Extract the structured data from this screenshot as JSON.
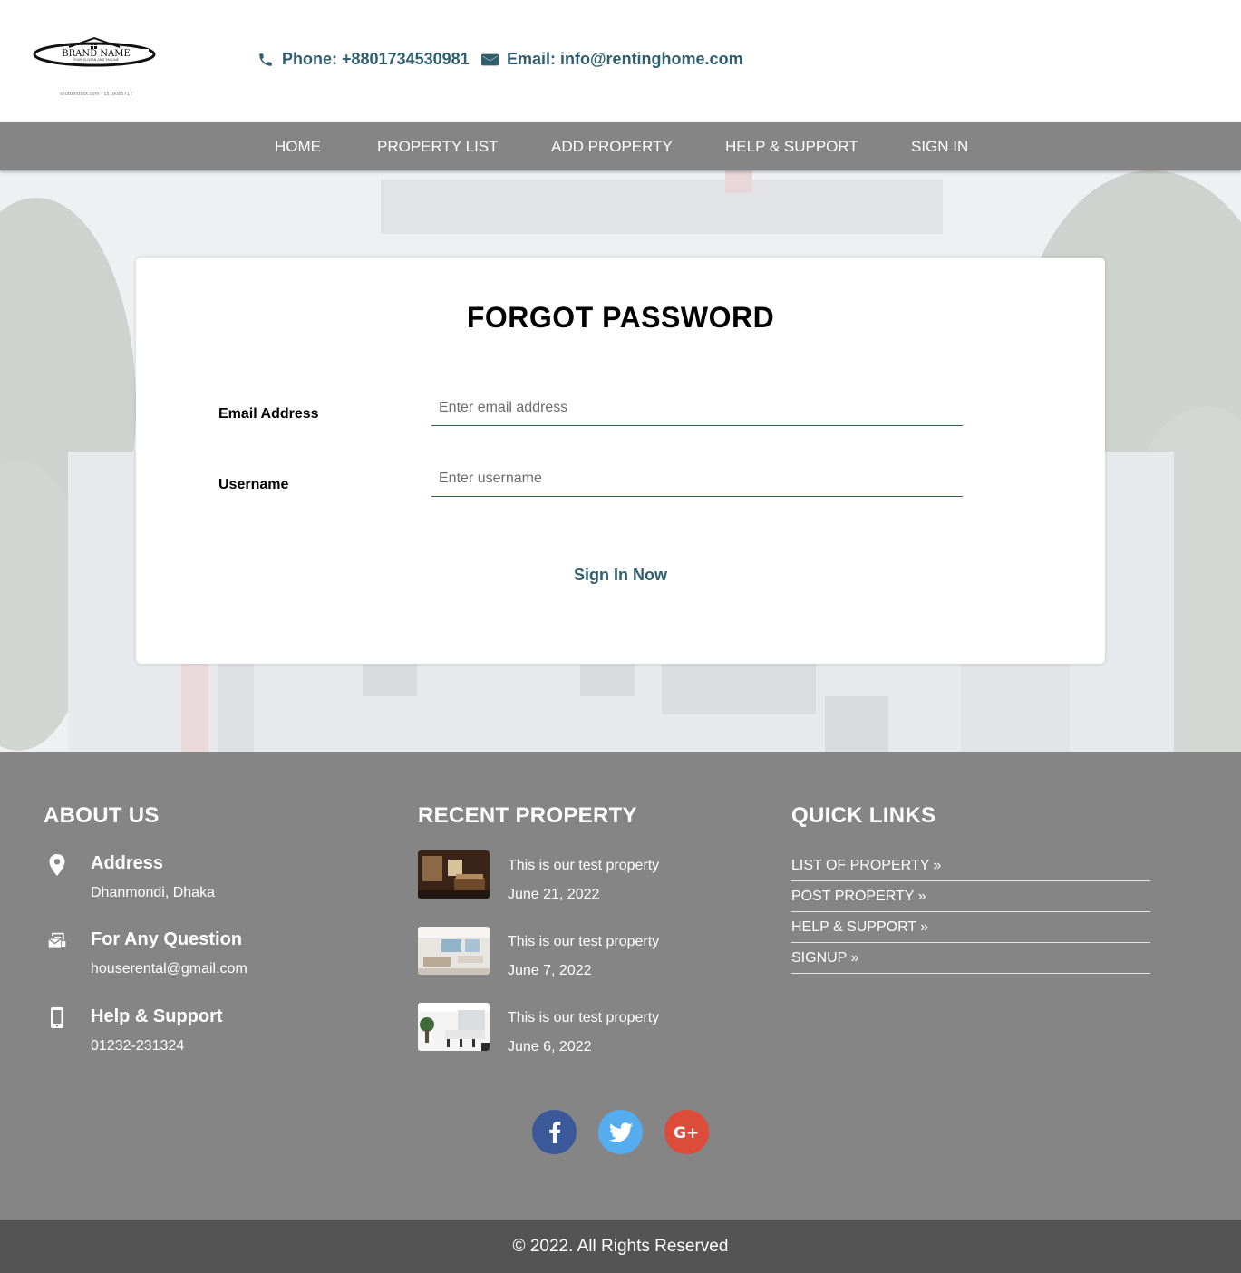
{
  "header": {
    "logo_text": "BRAND NAME",
    "logo_tagline": "YOUR SLOGAN AND TAGLINE",
    "logo_watermark": "shutterstock.com · 1578085717",
    "phone": "Phone: +8801734530981",
    "email": "Email: info@rentinghome.com"
  },
  "nav": {
    "items": [
      "HOME",
      "PROPERTY LIST",
      "ADD PROPERTY",
      "HELP & SUPPORT",
      "SIGN IN"
    ]
  },
  "form": {
    "title": "FORGOT PASSWORD",
    "email_label": "Email Address",
    "email_placeholder": "Enter email address",
    "username_label": "Username",
    "username_placeholder": "Enter username",
    "submit_label": "Sign In Now"
  },
  "footer": {
    "about": {
      "title": "ABOUT US",
      "items": [
        {
          "icon": "location-pin-icon",
          "heading": "Address",
          "text": "Dhanmondi, Dhaka"
        },
        {
          "icon": "mail-question-icon",
          "heading": "For Any Question",
          "text": "houserental@gmail.com"
        },
        {
          "icon": "mobile-phone-icon",
          "heading": "Help & Support",
          "text": "01232-231324"
        }
      ]
    },
    "recent": {
      "title": "RECENT PROPERTY",
      "items": [
        {
          "title": "This is our test property",
          "date": "June 21, 2022"
        },
        {
          "title": "This is our test property",
          "date": "June 7, 2022"
        },
        {
          "title": "This is our test property",
          "date": "June 6, 2022"
        }
      ]
    },
    "quick_links": {
      "title": "QUICK LINKS",
      "items": [
        "LIST OF PROPERTY »",
        "POST PROPERTY »",
        "HELP & SUPPORT »",
        "SIGNUP »"
      ]
    },
    "social": [
      "facebook-icon",
      "twitter-icon",
      "google-plus-icon"
    ],
    "copyright": "© 2022. All Rights Reserved"
  },
  "colors": {
    "accent": "#2f5f6e",
    "nav_bg": "#858585",
    "footer_bg": "#858585",
    "copyright_bg": "#545454",
    "facebook": "#3b5998",
    "twitter": "#55acee",
    "google_plus": "#dd4b39"
  }
}
